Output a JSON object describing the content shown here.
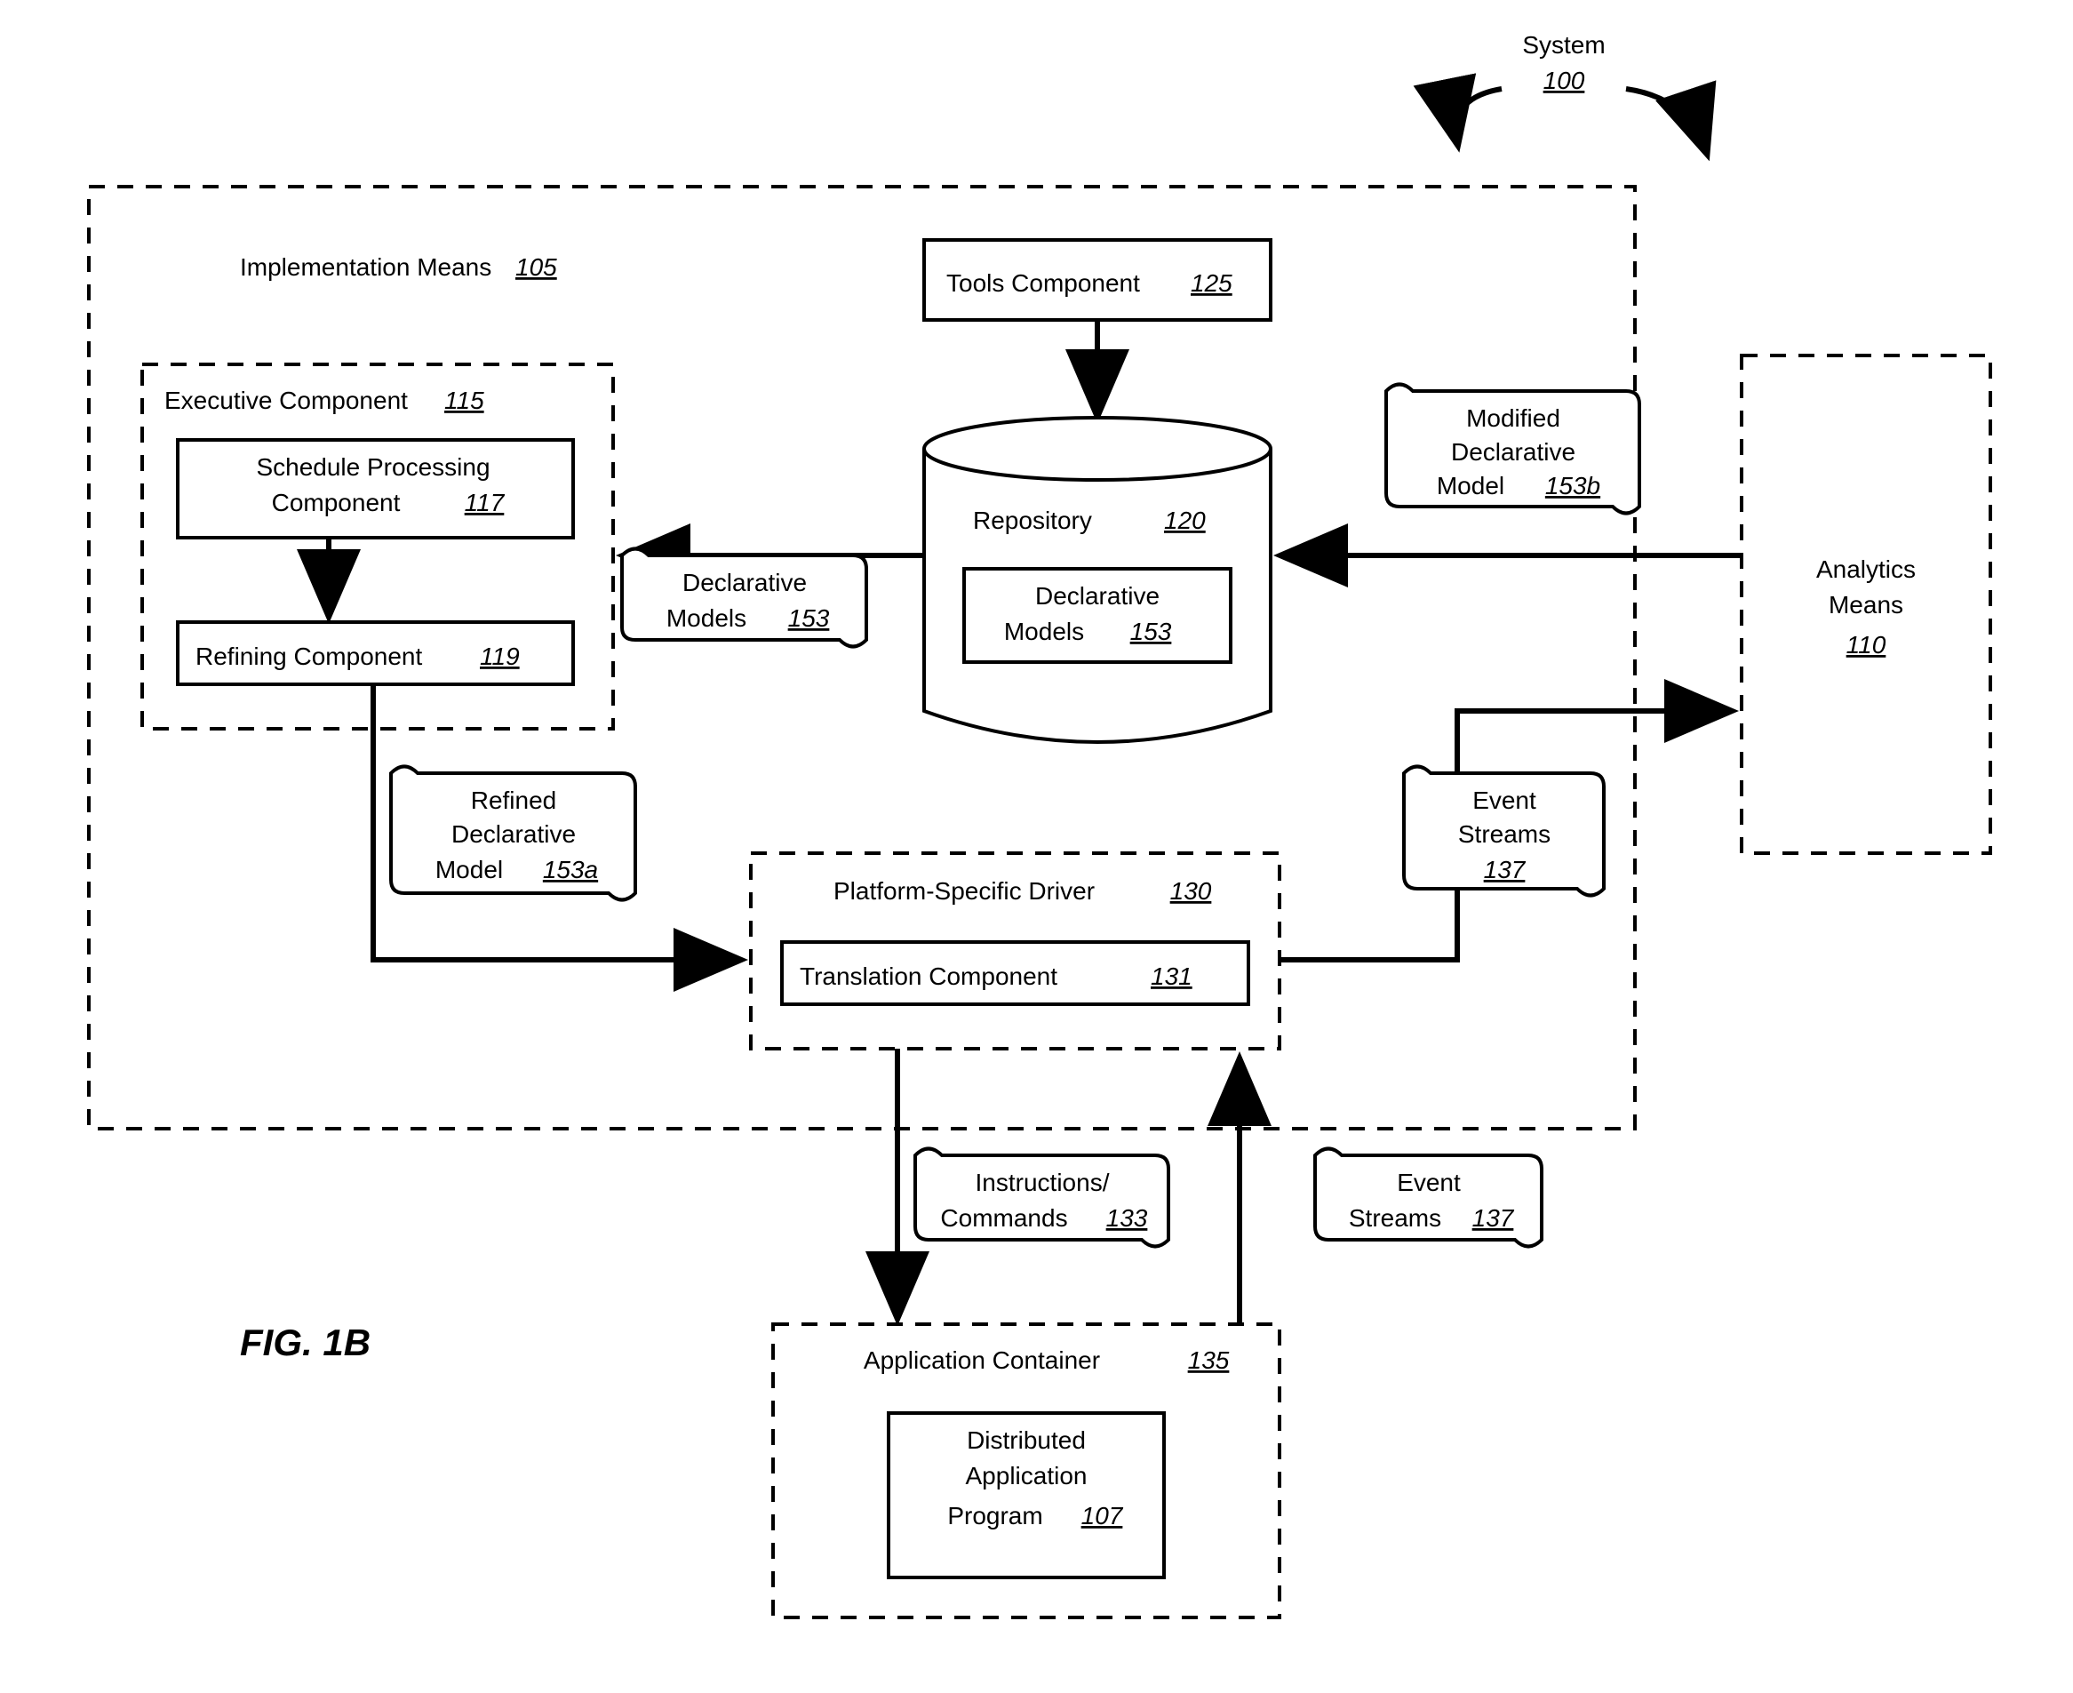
{
  "figure_label": "FIG.  1B",
  "system": {
    "label": "System",
    "ref": "100"
  },
  "impl": {
    "label": "Implementation Means",
    "ref": "105"
  },
  "tools": {
    "label": "Tools Component",
    "ref": "125"
  },
  "repo": {
    "label": "Repository",
    "ref": "120"
  },
  "repo_models": {
    "label": "Declarative",
    "label2": "Models",
    "ref": "153"
  },
  "exec": {
    "label": "Executive Component",
    "ref": "115"
  },
  "sched": {
    "label1": "Schedule Processing",
    "label2": "Component",
    "ref": "117"
  },
  "refine": {
    "label": "Refining Component",
    "ref": "119"
  },
  "decl_models_doc": {
    "label1": "Declarative",
    "label2": "Models",
    "ref": "153"
  },
  "refined_doc": {
    "label1": "Refined",
    "label2": "Declarative",
    "label3": "Model",
    "ref": "153a"
  },
  "driver": {
    "label": "Platform-Specific Driver",
    "ref": "130"
  },
  "translation": {
    "label": "Translation Component",
    "ref": "131"
  },
  "instructions_doc": {
    "label1": "Instructions/",
    "label2": "Commands",
    "ref": "133"
  },
  "event_streams_doc": {
    "label1": "Event",
    "label2": "Streams",
    "ref": "137"
  },
  "event_streams_doc2": {
    "label1": "Event",
    "label2": "Streams",
    "ref": "137"
  },
  "app_container": {
    "label": "Application Container",
    "ref": "135"
  },
  "dist_app": {
    "label1": "Distributed",
    "label2": "Application",
    "label3": "Program",
    "ref": "107"
  },
  "modified_doc": {
    "label1": "Modified",
    "label2": "Declarative",
    "label3": "Model",
    "ref": "153b"
  },
  "analytics": {
    "label1": "Analytics",
    "label2": "Means",
    "ref": "110"
  }
}
